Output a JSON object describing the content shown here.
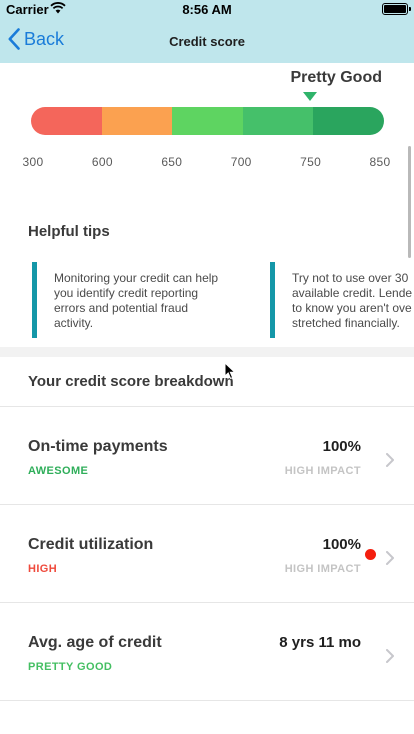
{
  "status_bar": {
    "carrier": "Carrier",
    "time": "8:56 AM"
  },
  "nav": {
    "back_label": "Back",
    "title": "Credit score"
  },
  "score": {
    "rating": "Pretty Good",
    "indicator_score": 750,
    "segment_colors": [
      "#f4665b",
      "#fba150",
      "#5ed461",
      "#45c06a",
      "#2aa55e"
    ],
    "ticks": [
      "300",
      "600",
      "650",
      "700",
      "750",
      "850"
    ]
  },
  "tips": {
    "title": "Helpful tips",
    "items": [
      {
        "text": "Monitoring your credit can help\nyou identify credit reporting\nerrors and potential fraud\nactivity."
      },
      {
        "text": "Try not to use over 30\navailable credit. Lende\nto know you aren't ove\nstretched financially."
      }
    ]
  },
  "breakdown": {
    "title": "Your credit score breakdown",
    "rows": [
      {
        "name": "On-time payments",
        "status": "AWESOME",
        "status_color": "#2fae5a",
        "value": "100%",
        "impact": "HIGH IMPACT",
        "alert": false
      },
      {
        "name": "Credit utilization",
        "status": "HIGH",
        "status_color": "#ef4a3c",
        "value": "100%",
        "impact": "HIGH IMPACT",
        "alert": true
      },
      {
        "name": "Avg. age of credit",
        "status": "PRETTY GOOD",
        "status_color": "#44bf62",
        "value": "8 yrs 11 mo",
        "impact": "",
        "alert": false
      }
    ]
  },
  "colors": {
    "accent": "#1a7cd9",
    "nav_bg": "#bfe6ec",
    "tip_bar": "#1497a8",
    "alert": "#f41e0e"
  }
}
